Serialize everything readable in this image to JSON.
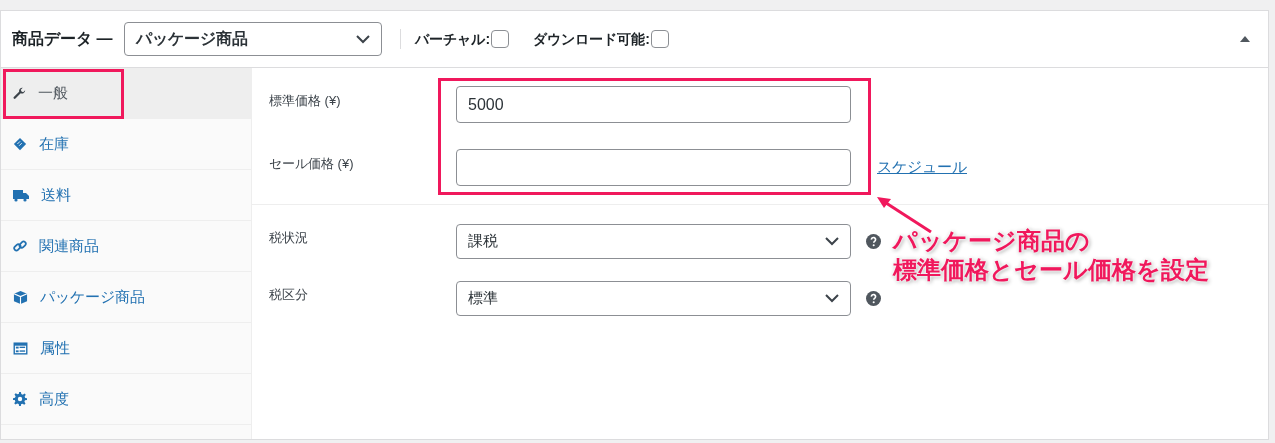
{
  "header": {
    "title": "商品データ —",
    "product_type": {
      "value": "パッケージ商品"
    },
    "options": [
      {
        "label": "バーチャル:",
        "checked": false
      },
      {
        "label": "ダウンロード可能:",
        "checked": false
      }
    ]
  },
  "sidebar": {
    "items": [
      {
        "label": "一般",
        "selected": true
      },
      {
        "label": "在庫",
        "selected": false
      },
      {
        "label": "送料",
        "selected": false
      },
      {
        "label": "関連商品",
        "selected": false
      },
      {
        "label": "パッケージ商品",
        "selected": false
      },
      {
        "label": "属性",
        "selected": false
      },
      {
        "label": "高度",
        "selected": false
      }
    ]
  },
  "pricing": {
    "fields": [
      {
        "label": "標準価格 (¥)",
        "value": "5000"
      },
      {
        "label": "セール価格 (¥)",
        "link": "スケジュール"
      }
    ]
  },
  "tax": {
    "fields": [
      {
        "label": "税状況",
        "value": "課税"
      },
      {
        "label": "税区分",
        "value": "標準"
      }
    ]
  },
  "annotation": {
    "lines": [
      "パッケージ商品の",
      "標準価格とセール価格を設定"
    ]
  }
}
